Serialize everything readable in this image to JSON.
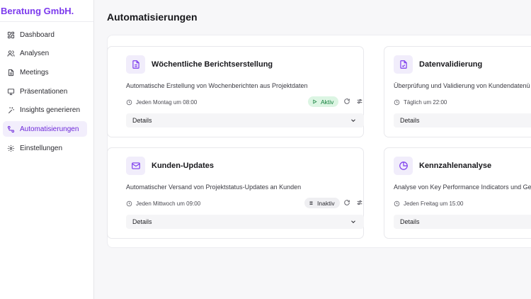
{
  "sidebar": {
    "brand": "Beratung GmbH.",
    "items": [
      {
        "label": "Dashboard",
        "icon": "dashboard-icon",
        "active": false
      },
      {
        "label": "Analysen",
        "icon": "users-icon",
        "active": false
      },
      {
        "label": "Meetings",
        "icon": "document-icon",
        "active": false
      },
      {
        "label": "Präsentationen",
        "icon": "presentation-icon",
        "active": false
      },
      {
        "label": "Insights generieren",
        "icon": "sparkles-icon",
        "active": false
      },
      {
        "label": "Automatisierungen",
        "icon": "workflow-icon",
        "active": true
      },
      {
        "label": "Einstellungen",
        "icon": "gear-icon",
        "active": false
      }
    ]
  },
  "main": {
    "title": "Automatisierungen",
    "cards": [
      {
        "title": "Wöchentliche Berichtserstellung",
        "icon": "file-text-icon",
        "description": "Automatische Erstellung von Wochenberichten aus Projektdaten",
        "schedule": "Jeden Montag um 08:00",
        "status": "Aktiv",
        "details": "Details"
      },
      {
        "title": "Datenvalidierung",
        "icon": "file-check-icon",
        "description": "Überprüfung und Validierung von Kundendatenü",
        "schedule": "Täglich um 22:00",
        "status": "",
        "details": "Details"
      },
      {
        "title": "Kunden-Updates",
        "icon": "mail-icon",
        "description": "Automatischer Versand von Projektstatus-Updates an Kunden",
        "schedule": "Jeden Mittwoch um 09:00",
        "status": "Inaktiv",
        "details": "Details"
      },
      {
        "title": "Kennzahlenanalyse",
        "icon": "pie-chart-icon",
        "description": "Analyse von Key Performance Indicators und Ger",
        "schedule": "Jeden Freitag um 15:00",
        "status": "",
        "details": "Details"
      }
    ]
  },
  "colors": {
    "accent": "#7c3aed",
    "active_bg": "#f2eefc",
    "status_active_bg": "#dcf5e3",
    "status_active_text": "#15803d",
    "status_inactive_bg": "#efeff2"
  }
}
